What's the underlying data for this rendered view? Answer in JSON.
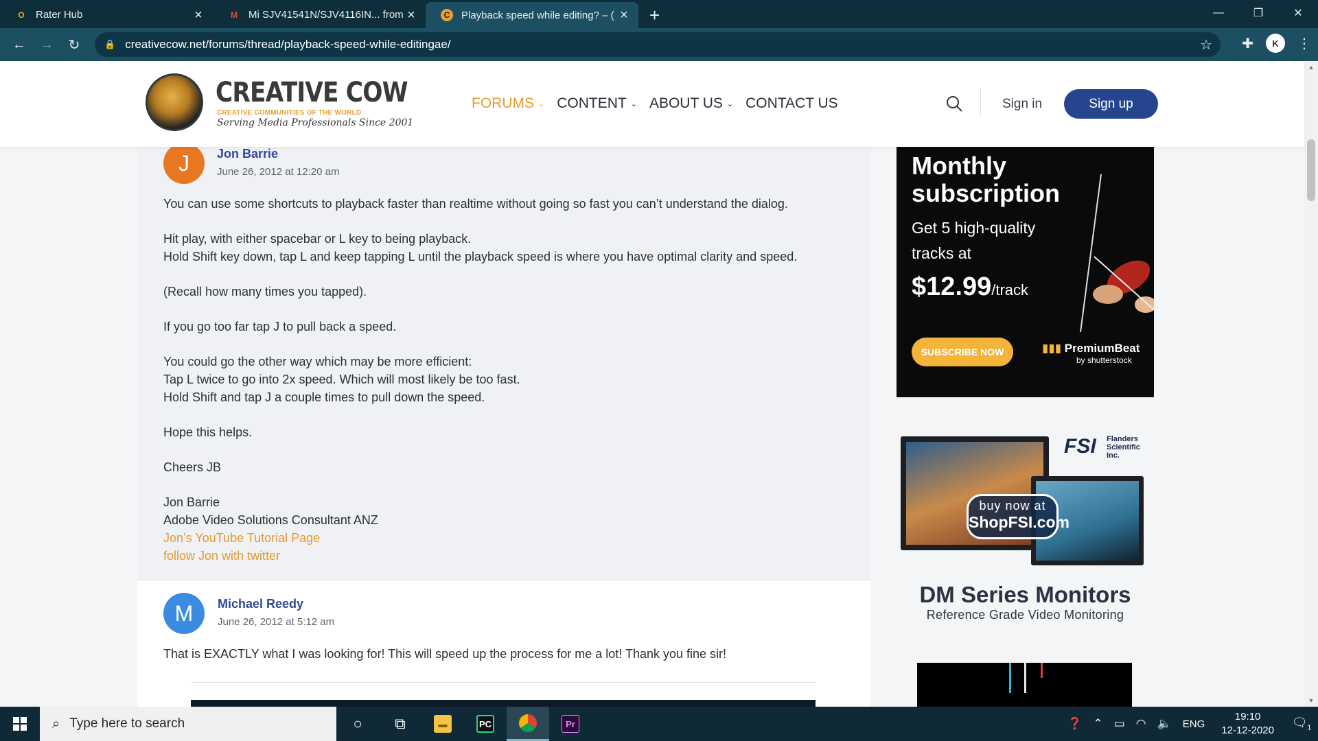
{
  "browser": {
    "tabs": [
      {
        "title": "Rater Hub",
        "favicon": "O",
        "favicon_color": "#f7a21b"
      },
      {
        "title": "Mi SJV41541N/SJV4116IN... from",
        "favicon": "M",
        "favicon_color": "#ea4335"
      },
      {
        "title": "Playback speed while editing? – (",
        "favicon": "C",
        "favicon_color": "#e8a02e"
      }
    ],
    "url": "creativecow.net/forums/thread/playback-speed-while-editingae/",
    "profile_initial": "K"
  },
  "site": {
    "logo": {
      "name": "CREATIVE COW",
      "tagline1": "CREATIVE COMMUNITIES OF THE WORLD",
      "tagline2": "Serving Media Professionals Since 2001"
    },
    "nav": [
      {
        "label": "FORUMS",
        "has_dropdown": true,
        "active": true
      },
      {
        "label": "CONTENT",
        "has_dropdown": true,
        "active": false
      },
      {
        "label": "ABOUT US",
        "has_dropdown": true,
        "active": false
      },
      {
        "label": "CONTACT US",
        "has_dropdown": false,
        "active": false
      }
    ],
    "signin": "Sign in",
    "signup": "Sign up",
    "colors": {
      "accent": "#e89a2b",
      "primary": "#26458f"
    }
  },
  "posts": [
    {
      "author": "Jon Barrie",
      "initial": "J",
      "avatar_color": "#e87722",
      "date": "June 26, 2012 at 12:20 am",
      "paragraphs": [
        [
          "You can use some shortcuts to playback faster than realtime without going so fast you can’t understand the dialog."
        ],
        [
          "Hit play, with either spacebar or L key to being playback.",
          "Hold Shift key down, tap L and keep tapping L until the playback speed is where you have optimal clarity and speed."
        ],
        [
          "(Recall how many times you tapped)."
        ],
        [
          "If you go too far tap J to pull back a speed."
        ],
        [
          "You could go the other way which may be more efficient:",
          "Tap L twice to go into 2x speed. Which will most likely be too fast.",
          "Hold Shift and tap J a couple times to pull down the speed."
        ],
        [
          "Hope this helps."
        ],
        [
          "Cheers JB"
        ],
        [
          "Jon Barrie",
          "Adobe Video Solutions Consultant ANZ"
        ]
      ],
      "links": [
        "Jon’s YouTube Tutorial Page",
        "follow Jon with twitter"
      ]
    },
    {
      "author": "Michael Reedy",
      "initial": "M",
      "avatar_color": "#3b8be0",
      "date": "June 26, 2012 at 5:12 am",
      "paragraphs": [
        [
          "That is EXACTLY what I was looking for! This will speed up the process for me a lot! Thank you fine sir!"
        ]
      ]
    }
  ],
  "ads": {
    "premiumbeat": {
      "headline": "Monthly subscription",
      "subtext": "Get 5 high-quality tracks at",
      "price": "$12.99",
      "price_unit": "/track",
      "button": "SUBSCRIBE NOW",
      "brand": "PremiumBeat",
      "brand_sub": "by shutterstock"
    },
    "fsi": {
      "logo": "FSI",
      "logo_sub": "Flanders Scientific Inc.",
      "bubble_line1": "buy now at",
      "bubble_line2": "ShopFSI.com",
      "title": "DM Series Monitors",
      "subtitle": "Reference Grade Video Monitoring"
    }
  },
  "taskbar": {
    "search_placeholder": "Type here to search",
    "language": "ENG",
    "time": "19:10",
    "date": "12-12-2020",
    "notification_count": "1"
  }
}
